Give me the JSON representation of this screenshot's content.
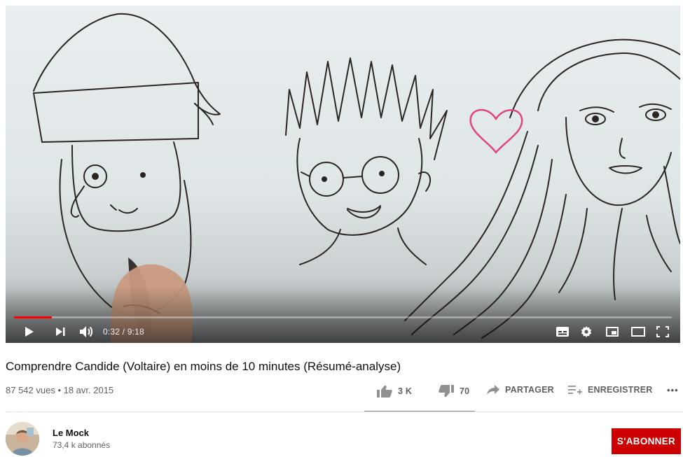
{
  "player": {
    "current_time": "0:32",
    "duration": "9:18",
    "time_display": "0:32 / 9:18",
    "progress_fraction": 0.057,
    "progress_color": "#ff0000",
    "controls": [
      "play-icon",
      "next-icon",
      "volume-icon",
      "subtitles-icon",
      "settings-icon",
      "miniplayer-icon",
      "theater-icon",
      "fullscreen-icon"
    ]
  },
  "video": {
    "title": "Comprendre Candide (Voltaire) en moins de 10 minutes (Résumé-analyse)",
    "views": "87 542 vues",
    "separator": "•",
    "date": "18 avr. 2015",
    "meta_line": "87 542 vues • 18 avr. 2015"
  },
  "actions": {
    "like_count": "3 K",
    "dislike_count": "70",
    "share_label": "PARTAGER",
    "save_label": "ENREGISTRER",
    "more_label": "•••"
  },
  "channel": {
    "name": "Le Mock",
    "subscribers": "73,4 k abonnés",
    "subscribe_label": "S'ABONNER",
    "subscribe_color": "#cc0000"
  }
}
